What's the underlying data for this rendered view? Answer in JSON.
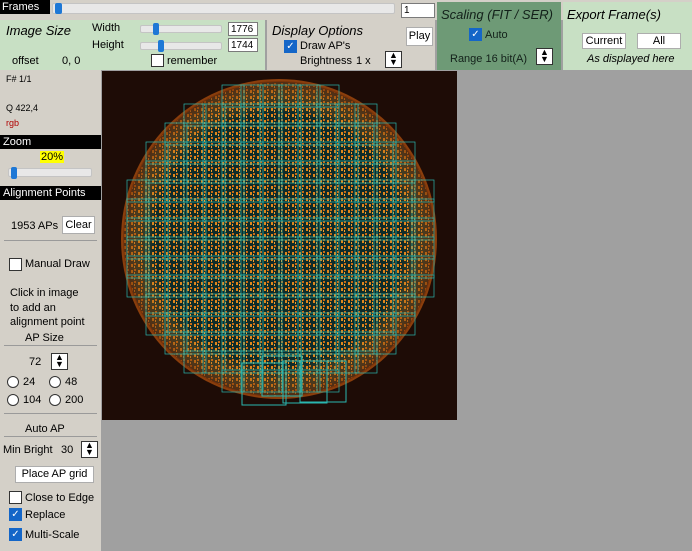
{
  "frames": {
    "label": "Frames",
    "value": "1",
    "slider_fraction": 0.0
  },
  "image_size": {
    "title": "Image Size",
    "width_label": "Width",
    "width_value": "1776",
    "height_label": "Height",
    "height_value": "1744",
    "offset_label": "offset",
    "offset_value": "0, 0",
    "remember_label": "remember",
    "remember_checked": false
  },
  "display": {
    "title": "Display Options",
    "draw_aps_label": "Draw AP's",
    "draw_aps_checked": true,
    "brightness_label": "Brightness",
    "brightness_value": "1 x",
    "play_label": "Play"
  },
  "scaling": {
    "title": "Scaling (FIT / SER)",
    "auto_label": "Auto",
    "auto_checked": true,
    "range_label": "Range 16 bit(A)"
  },
  "export": {
    "title": "Export Frame(s)",
    "current_label": "Current",
    "all_label": "All",
    "note": "As displayed here"
  },
  "info": {
    "frame": "F# 1/1",
    "quality": "Q  422,4",
    "color": "rgb"
  },
  "zoom": {
    "label": "Zoom",
    "value": "20%",
    "slider_fraction": 0.0
  },
  "alignment": {
    "label": "Alignment Points",
    "count": "1953 APs",
    "clear_label": "Clear",
    "manual_draw_label": "Manual Draw",
    "hint_line1": "Click in image",
    "hint_line2": "to add an",
    "hint_line3": "alignment point",
    "ap_size_label": "AP Size",
    "ap_size_value": "72",
    "size_options": [
      "24",
      "48",
      "104",
      "200"
    ],
    "auto_ap_label": "Auto AP",
    "min_bright_label": "Min Bright",
    "min_bright_value": "30",
    "place_grid_label": "Place AP grid",
    "close_to_edge_label": "Close to Edge",
    "replace_label": "Replace",
    "multi_scale_label": "Multi-Scale"
  },
  "colors": {
    "accent": "#1466c8",
    "ap_box": "#2ab7b0",
    "sun_orange": "#e0861c",
    "canvas_bg": "#1e0c06"
  }
}
